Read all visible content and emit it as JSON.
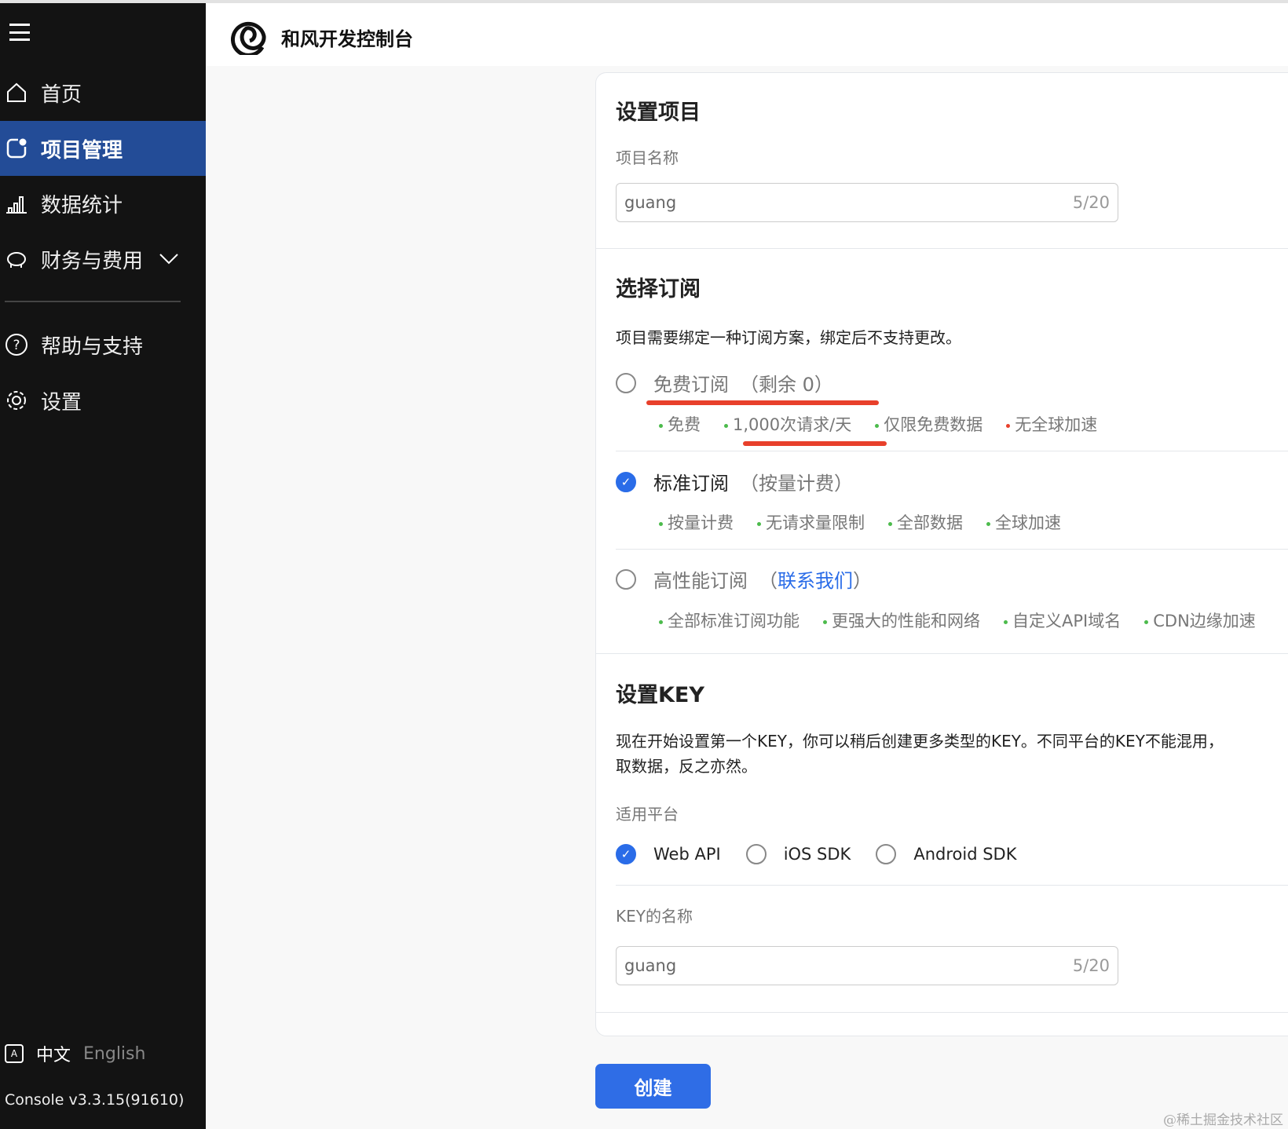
{
  "header": {
    "title": "和风开发控制台"
  },
  "sidebar": {
    "items": [
      {
        "label": "首页"
      },
      {
        "label": "项目管理"
      },
      {
        "label": "数据统计"
      },
      {
        "label": "财务与费用"
      },
      {
        "label": "帮助与支持"
      },
      {
        "label": "设置"
      }
    ],
    "lang_zh": "中文",
    "lang_en": "English",
    "version": "Console v3.3.15(91610)"
  },
  "project": {
    "title": "设置项目",
    "name_label": "项目名称",
    "name_value": "guang",
    "name_count": "5/20"
  },
  "subscription": {
    "title": "选择订阅",
    "desc": "项目需要绑定一种订阅方案，绑定后不支持更改。",
    "options": [
      {
        "name": "免费订阅",
        "paren_open": "（",
        "note": "剩余 0",
        "paren_close": "）",
        "selected": false,
        "features": [
          "免费",
          "1,000次请求/天",
          "仅限免费数据",
          "无全球加速"
        ]
      },
      {
        "name": "标准订阅",
        "paren_open": "（",
        "note": "按量计费",
        "paren_close": "）",
        "selected": true,
        "features": [
          "按量计费",
          "无请求量限制",
          "全部数据",
          "全球加速"
        ]
      },
      {
        "name": "高性能订阅",
        "paren_open": "（",
        "note": "联系我们",
        "paren_close": "）",
        "selected": false,
        "features": [
          "全部标准订阅功能",
          "更强大的性能和网络",
          "自定义API域名",
          "CDN边缘加速"
        ]
      }
    ]
  },
  "key": {
    "title": "设置KEY",
    "desc_line1": "现在开始设置第一个KEY，你可以稍后创建更多类型的KEY。不同平台的KEY不能混用，",
    "desc_line2": "取数据，反之亦然。",
    "platform_label": "适用平台",
    "platforms": [
      {
        "label": "Web API",
        "selected": true
      },
      {
        "label": "iOS SDK",
        "selected": false
      },
      {
        "label": "Android SDK",
        "selected": false
      }
    ],
    "name_label": "KEY的名称",
    "name_value": "guang",
    "name_count": "5/20"
  },
  "create_label": "创建",
  "watermark": "@稀土掘金技术社区",
  "colors": {
    "accent": "#2f6de6",
    "sidebar_active": "#234c97",
    "sidebar_bg": "#131313",
    "ok_dot": "#4cbb4c",
    "bad_dot": "#e8402b"
  }
}
